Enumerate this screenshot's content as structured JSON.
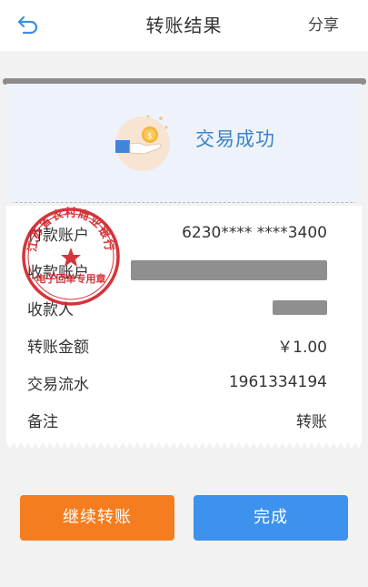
{
  "header": {
    "title": "转账结果",
    "share_label": "分享",
    "back_icon": "back-arrow-icon"
  },
  "result": {
    "status_text": "交易成功",
    "icon": "hand-coin-icon"
  },
  "details": [
    {
      "label": "付款账户",
      "value": "6230**** ****3400"
    },
    {
      "label": "收款账户",
      "value": ""
    },
    {
      "label": "收款人",
      "value": ""
    },
    {
      "label": "转账金额",
      "value": "￥1.00"
    },
    {
      "label": "交易流水",
      "value": "1961334194"
    },
    {
      "label": "备注",
      "value": "转账"
    }
  ],
  "stamp": {
    "outer_text": "江苏省农村商业银行",
    "inner_text": "电子回单专用章",
    "color": "#d2232a"
  },
  "buttons": {
    "continue_label": "继续转账",
    "done_label": "完成"
  },
  "colors": {
    "accent_blue": "#3c92ec",
    "accent_orange": "#f57d1f",
    "success_text": "#3d82c8"
  }
}
